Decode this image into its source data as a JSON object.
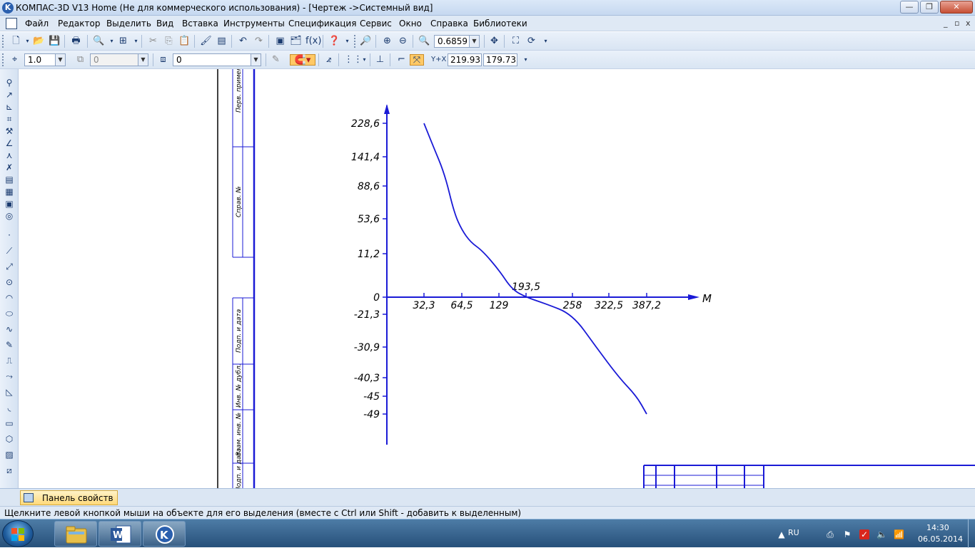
{
  "window": {
    "title": "КОМПАС-3D V13 Home (Не для коммерческого использования) - [Чертеж ->Системный вид]",
    "app_icon_letter": "K",
    "min_label": "—",
    "max_label": "❐",
    "close_label": "✕"
  },
  "menu": {
    "items": [
      "Файл",
      "Редактор",
      "Выделить",
      "Вид",
      "Вставка",
      "Инструменты",
      "Спецификация",
      "Сервис",
      "Окно",
      "Справка",
      "Библиотеки"
    ],
    "mdi_min": "_",
    "mdi_restore": "▫",
    "mdi_close": "x"
  },
  "toolbar1": {
    "zoom_value": "0.6859"
  },
  "toolbar2": {
    "step_value": "1.0",
    "layer_value": "0",
    "state_value": "0",
    "coord_x": "219.933",
    "coord_y": "179.735"
  },
  "chart_data": {
    "type": "line",
    "x_axis_label": "M",
    "x_ticks": [
      "32,3",
      "64,5",
      "129",
      "193,5",
      "258",
      "322,5",
      "387,2"
    ],
    "y_ticks": [
      "228,6",
      "141,4",
      "88,6",
      "53,6",
      "11,2",
      "0",
      "-21,3",
      "-30,9",
      "-40,3",
      "-45",
      "-49"
    ],
    "series": [
      {
        "color": "#1a1ad6",
        "points": [
          [
            32.3,
            228.6
          ],
          [
            40,
            170
          ],
          [
            50,
            110
          ],
          [
            58,
            60
          ],
          [
            64.5,
            40
          ],
          [
            80,
            25
          ],
          [
            100,
            15
          ],
          [
            129,
            7
          ],
          [
            160,
            2
          ],
          [
            193.5,
            0
          ],
          [
            220,
            -8
          ],
          [
            258,
            -21.3
          ],
          [
            300,
            -30.9
          ],
          [
            340,
            -40.3
          ],
          [
            370,
            -45
          ],
          [
            387.2,
            -49
          ]
        ]
      }
    ]
  },
  "title_block": {
    "labels": [
      "Перв. примен.",
      "Справ. №",
      "Подп. и дата",
      "Инв. № дубл.",
      "Взам. инв. №",
      "Подп. и дата"
    ]
  },
  "properties_panel": {
    "tab_label": "Панель свойств"
  },
  "status": {
    "message": "Щелкните левой кнопкой мыши на объекте для его выделения (вместе с Ctrl или Shift - добавить к выделенным)"
  },
  "taskbar": {
    "language": "RU",
    "time": "14:30",
    "date": "06.05.2014"
  }
}
